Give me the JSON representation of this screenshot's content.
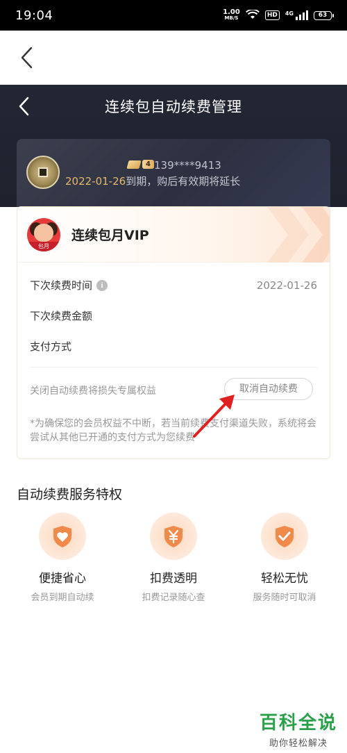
{
  "status_bar": {
    "time": "19:04",
    "net_speed": "1.00",
    "net_unit": "MB/S",
    "hd": "HD",
    "network": "4G",
    "battery": "63"
  },
  "header": {
    "title": "连续包自动续费管理"
  },
  "user": {
    "level": "4",
    "phone": "139****9413",
    "expire_date": "2022-01-26",
    "expire_text": "到期，购后有效期将延长"
  },
  "product": {
    "name": "连续包月VIP",
    "logo_tag": "包月",
    "rows": [
      {
        "label": "下次续费时间",
        "value": "2022-01-26"
      },
      {
        "label": "下次续费金额",
        "value": ""
      },
      {
        "label": "支付方式",
        "value": ""
      }
    ],
    "loss_text": "关闭自动续费将损失专属权益",
    "cancel_label": "取消自动续费",
    "note": "*为确保您的会员权益不中断，若当前续费支付渠道失败，系统将会尝试从其他已开通的支付方式为您续费"
  },
  "privileges": {
    "title": "自动续费服务特权",
    "items": [
      {
        "name": "便捷省心",
        "desc": "会员到期自动续",
        "icon": "heart-shield-icon"
      },
      {
        "name": "扣费透明",
        "desc": "扣费记录随心查",
        "icon": "yen-shield-icon"
      },
      {
        "name": "轻松无忧",
        "desc": "服务随时可取消",
        "icon": "check-shield-icon"
      }
    ]
  },
  "watermark": {
    "main": "百科全说",
    "sub": "助你轻松解决"
  },
  "colors": {
    "dark_header": "#1f222d",
    "gold": "#e7b86c",
    "accent_orange": "#f08a4b",
    "arrow_red": "#e02020"
  }
}
